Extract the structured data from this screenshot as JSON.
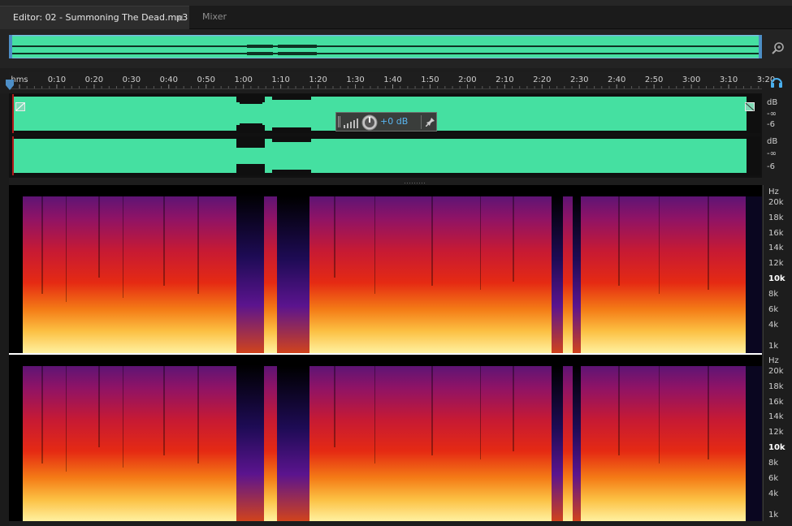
{
  "tabs": {
    "editor_label": "Editor: 02 - Summoning The Dead.mp3",
    "editor_menu": "≡",
    "mixer_label": "Mixer"
  },
  "ruler": {
    "ticks": [
      "hms",
      "0:10",
      "0:20",
      "0:30",
      "0:40",
      "0:50",
      "1:00",
      "1:10",
      "1:20",
      "1:30",
      "1:40",
      "1:50",
      "2:00",
      "2:10",
      "2:20",
      "2:30",
      "2:40",
      "2:50",
      "3:00",
      "3:10",
      "3:20"
    ]
  },
  "hud": {
    "value": "+0 dB"
  },
  "amplitude_scale": {
    "unit": "dB",
    "labels": [
      "-∞",
      "-6"
    ]
  },
  "frequency_scale": {
    "unit": "Hz",
    "labels": [
      "20k",
      "18k",
      "16k",
      "14k",
      "12k",
      "10k",
      "8k",
      "6k",
      "4k",
      "1k"
    ]
  },
  "colors": {
    "waveform": "#45e0a1",
    "selection_edge": "#4d8ec6",
    "hud_value": "#59b6f0"
  }
}
